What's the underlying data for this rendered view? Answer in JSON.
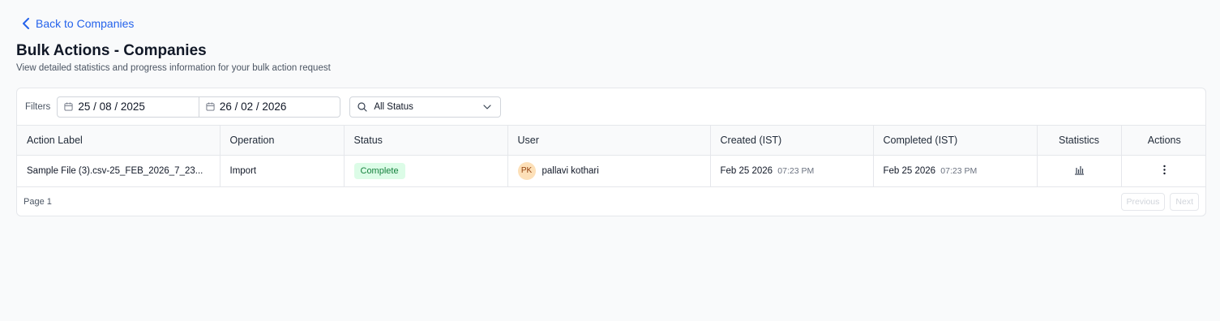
{
  "nav": {
    "back_label": "Back to Companies"
  },
  "header": {
    "title": "Bulk Actions - Companies",
    "subtitle": "View detailed statistics and progress information for your bulk action request"
  },
  "filters": {
    "label": "Filters",
    "start_date": "25 / 08 / 2025",
    "end_date": "26 / 02 / 2026",
    "status_selected": "All Status"
  },
  "table": {
    "columns": [
      "Action Label",
      "Operation",
      "Status",
      "User",
      "Created (IST)",
      "Completed (IST)",
      "Statistics",
      "Actions"
    ],
    "rows": [
      {
        "action_label": "Sample File (3).csv-25_FEB_2026_7_23...",
        "operation": "Import",
        "status": "Complete",
        "user_initials": "PK",
        "user_name": "pallavi kothari",
        "created_date": "Feb 25 2026",
        "created_time": "07:23 PM",
        "completed_date": "Feb 25 2026",
        "completed_time": "07:23 PM"
      }
    ]
  },
  "pagination": {
    "page_label": "Page 1",
    "previous_label": "Previous",
    "next_label": "Next"
  },
  "colors": {
    "accent": "#2563eb",
    "success_bg": "#dcfce7",
    "success_text": "#15803d",
    "avatar_bg": "#fde0b8"
  },
  "icons": {
    "back": "chevron-left-icon",
    "calendar": "calendar-icon",
    "search": "search-icon",
    "dropdown": "chevron-down-icon",
    "statistics": "bar-chart-icon",
    "actions": "more-vertical-icon"
  }
}
